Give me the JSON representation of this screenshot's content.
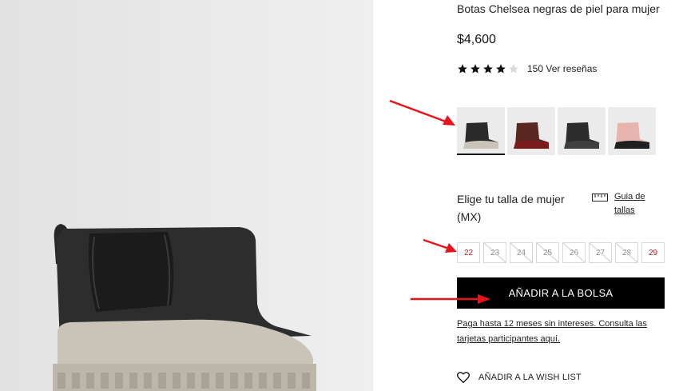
{
  "product": {
    "title": "Botas Chelsea negras de piel para mujer",
    "price": "$4,600",
    "rating": 4,
    "rating_max": 5,
    "reviews_text": "150 Ver reseñas"
  },
  "swatches": [
    {
      "name": "black-beige",
      "selected": true
    },
    {
      "name": "burgundy",
      "selected": false
    },
    {
      "name": "black-grey",
      "selected": false
    },
    {
      "name": "pink-black",
      "selected": false
    }
  ],
  "size_selector": {
    "title": "Elige tu talla de mujer (MX)",
    "guide_label": "Guia de tallas",
    "guide_icon": "ruler-icon",
    "sizes": [
      {
        "label": "22",
        "available": true
      },
      {
        "label": "23",
        "available": false
      },
      {
        "label": "24",
        "available": false
      },
      {
        "label": "25",
        "available": false
      },
      {
        "label": "26",
        "available": false
      },
      {
        "label": "27",
        "available": false
      },
      {
        "label": "28",
        "available": false
      },
      {
        "label": "29",
        "available": true
      }
    ]
  },
  "cart": {
    "add_label": "AÑADIR A LA BOLSA"
  },
  "installments_text": "Paga hasta 12 meses sin intereses. Consulta las tarjetas participantes aquí.",
  "wishlist": {
    "label": "AÑADIR A LA WISH LIST",
    "icon": "heart-icon"
  },
  "colors": {
    "accent": "#000000",
    "available_size": "#c0202a",
    "annotation_arrow": "#e8141b",
    "image_background": "#e9e9e9"
  }
}
